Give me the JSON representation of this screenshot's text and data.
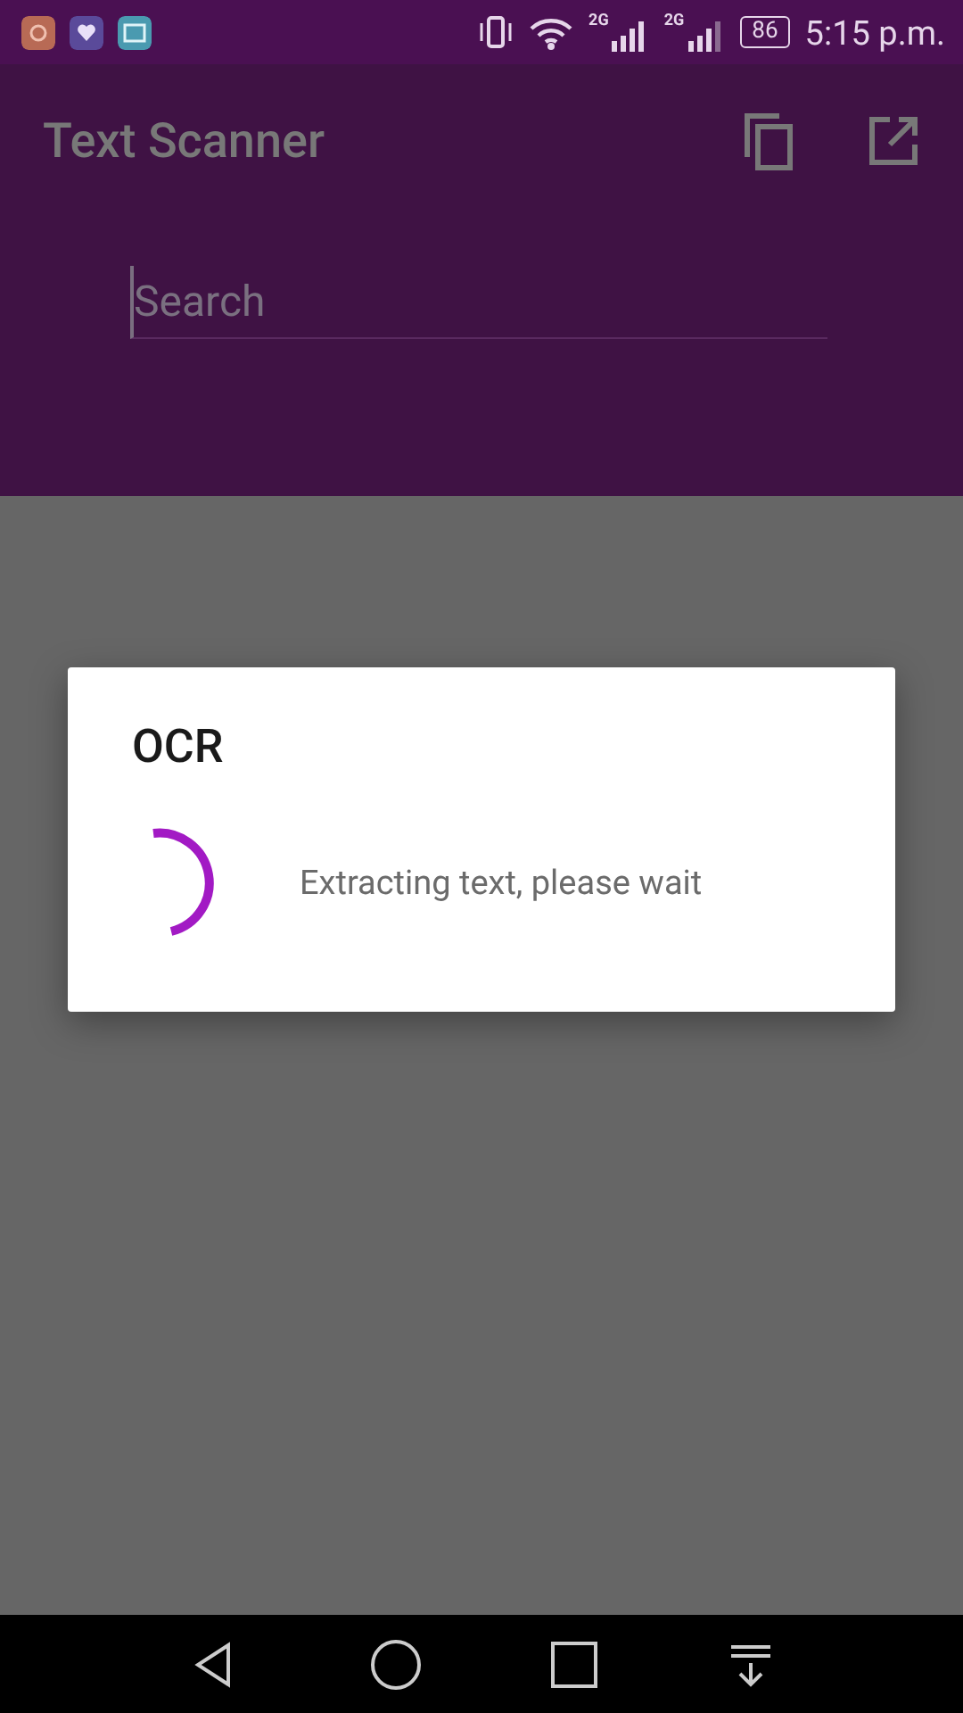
{
  "status_bar": {
    "network_labels": [
      "2G",
      "2G"
    ],
    "battery": "86",
    "time": "5:15 p.m."
  },
  "toolbar": {
    "title": "Text Scanner"
  },
  "search": {
    "placeholder": "Search"
  },
  "dialog": {
    "title": "OCR",
    "message": "Extracting text, please wait"
  }
}
